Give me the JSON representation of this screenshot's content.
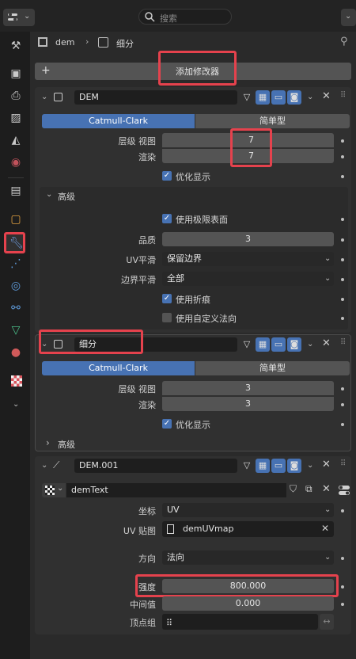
{
  "topbar": {
    "search_placeholder": "搜索"
  },
  "breadcrumb": {
    "object": "dem",
    "modifier": "细分"
  },
  "add_modifier_label": "添加修改器",
  "modifiers": [
    {
      "name": "DEM",
      "tabs": [
        "Catmull-Clark",
        "简单型"
      ],
      "levels_label": "层级 视图",
      "levels_value": "7",
      "render_label": "渲染",
      "render_value": "7",
      "optimal_label": "优化显示",
      "advanced_label": "高级",
      "limit_surface_label": "使用极限表面",
      "quality_label": "品质",
      "quality_value": "3",
      "uv_smooth_label": "UV平滑",
      "uv_smooth_value": "保留边界",
      "boundary_smooth_label": "边界平滑",
      "boundary_smooth_value": "全部",
      "use_creases_label": "使用折痕",
      "custom_normals_label": "使用自定义法向"
    },
    {
      "name": "细分",
      "tabs": [
        "Catmull-Clark",
        "简单型"
      ],
      "levels_label": "层级 视图",
      "levels_value": "3",
      "render_label": "渲染",
      "render_value": "3",
      "optimal_label": "优化显示",
      "advanced_label": "高级"
    },
    {
      "name": "DEM.001",
      "texture_name": "demText",
      "coords_label": "坐标",
      "coords_value": "UV",
      "uvmap_label": "UV 贴图",
      "uvmap_value": "demUVmap",
      "direction_label": "方向",
      "direction_value": "法向",
      "strength_label": "强度",
      "strength_value": "800.000",
      "midlevel_label": "中间值",
      "midlevel_value": "0.000",
      "vgroup_label": "顶点组"
    }
  ],
  "colors": {
    "accent": "#4772b3",
    "highlight": "#e5424d",
    "panel": "#303030",
    "field": "#545454"
  }
}
